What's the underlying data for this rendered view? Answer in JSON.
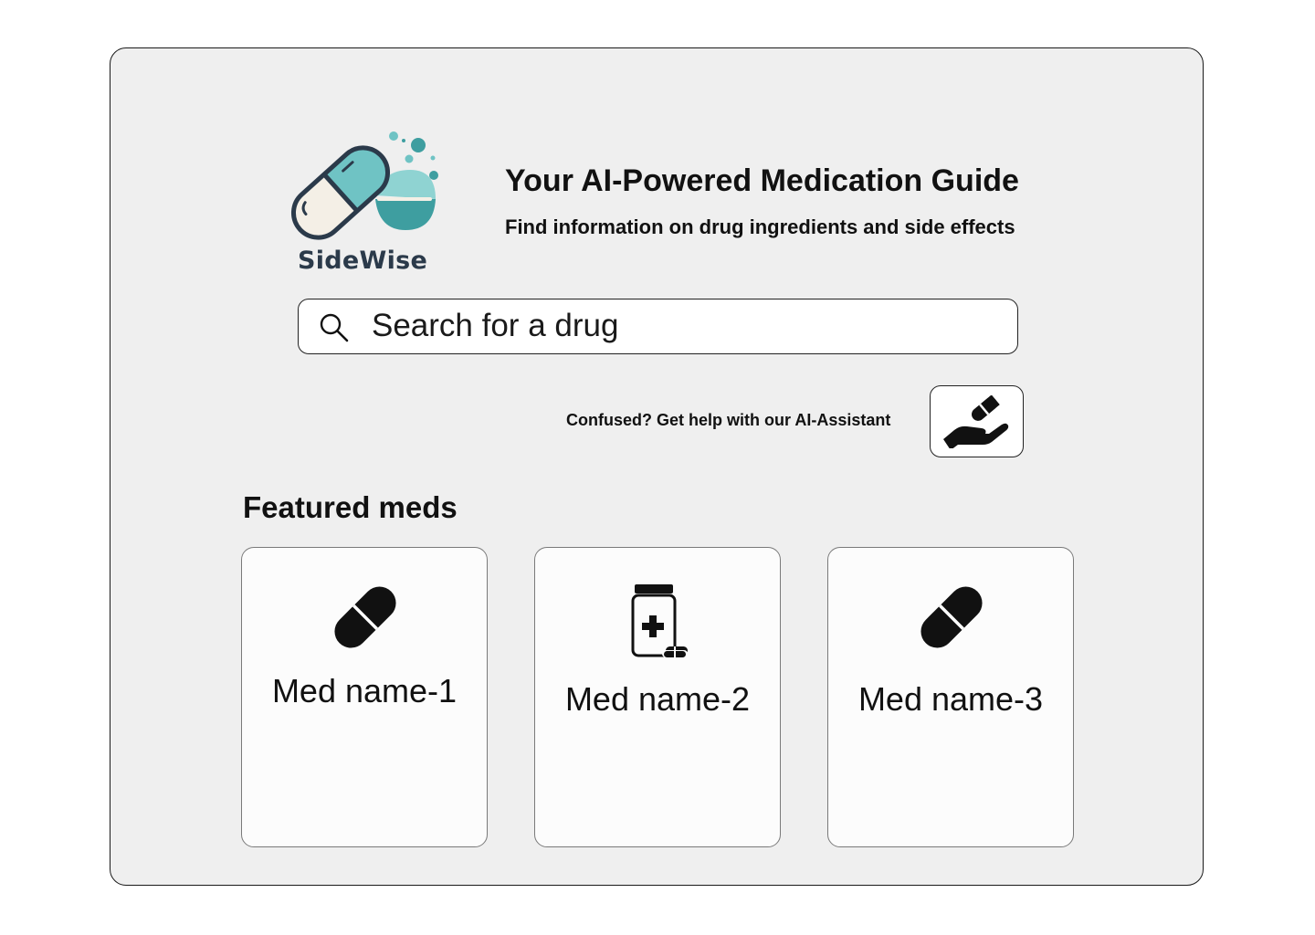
{
  "brand": {
    "name": "SideWise",
    "logo_icon": "capsule-logo-icon",
    "colors": {
      "teal": "#6fc3c4",
      "teal_dark": "#3e9ea0",
      "cream": "#f4efe6",
      "outline": "#2b3a4a"
    }
  },
  "hero": {
    "title": "Your AI-Powered Medication Guide",
    "subtitle": "Find information on drug ingredients and side effects"
  },
  "search": {
    "icon": "search-icon",
    "placeholder": "Search for a drug",
    "value": ""
  },
  "assistant": {
    "prompt": "Confused? Get help with our AI-Assistant",
    "button_icon": "hand-pill-icon"
  },
  "featured": {
    "title": "Featured meds",
    "items": [
      {
        "name": "Med name-1",
        "icon": "pill-icon"
      },
      {
        "name": "Med name-2",
        "icon": "medicine-bottle-icon"
      },
      {
        "name": "Med name-3",
        "icon": "pill-icon"
      }
    ]
  }
}
